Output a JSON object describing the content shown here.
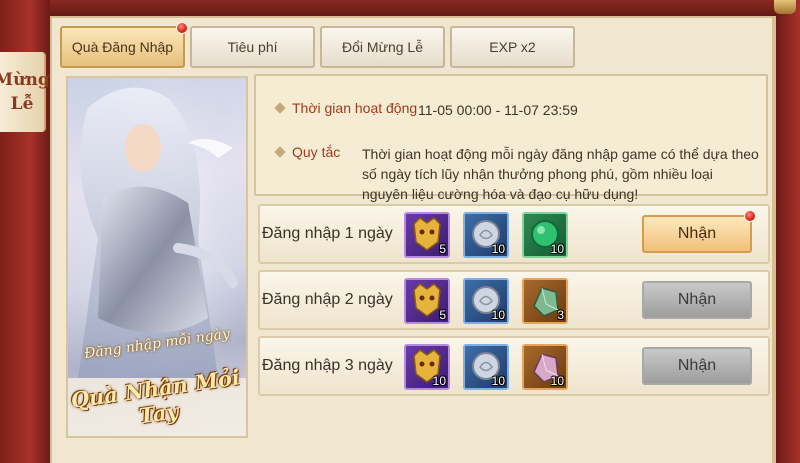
{
  "side_tab": {
    "line1": "Mừng",
    "line2": "Lễ"
  },
  "tabs": [
    {
      "label": "Quà Đăng Nhập",
      "active": true,
      "badge": true
    },
    {
      "label": "Tiêu phí",
      "active": false,
      "badge": false
    },
    {
      "label": "Đổi Mừng Lễ",
      "active": false,
      "badge": false
    },
    {
      "label": "EXP x2",
      "active": false,
      "badge": false
    }
  ],
  "banner": {
    "subtitle": "Đăng nhập mỗi ngày",
    "title": "Quà Nhận Mỏi Tay"
  },
  "info": {
    "time_label": "Thời gian hoạt động",
    "time_value": "11-05 00:00 - 11-07 23:59",
    "rules_label": "Quy tắc",
    "rules_value": "Thời gian hoạt động mỗi ngày đăng nhập game có thể dựa theo số ngày tích lũy nhận thưởng phong phú, gồm nhiều loại nguyên liệu cường hóa và đạo cụ hữu dụng!"
  },
  "rewards": [
    {
      "label": "Đăng nhập 1 ngày",
      "items": [
        {
          "icon": "golden-mask-icon",
          "quality": "purple",
          "count": "5"
        },
        {
          "icon": "silver-coin-icon",
          "quality": "blue",
          "count": "10"
        },
        {
          "icon": "jade-orb-icon",
          "quality": "green",
          "count": "10"
        }
      ],
      "button": "Nhận",
      "claimable": true
    },
    {
      "label": "Đăng nhập 2 ngày",
      "items": [
        {
          "icon": "golden-mask-icon",
          "quality": "purple",
          "count": "5"
        },
        {
          "icon": "silver-coin-icon",
          "quality": "blue",
          "count": "10"
        },
        {
          "icon": "green-crystal-icon",
          "quality": "orange",
          "count": "3"
        }
      ],
      "button": "Nhận",
      "claimable": false
    },
    {
      "label": "Đăng nhập 3 ngày",
      "items": [
        {
          "icon": "golden-mask-icon",
          "quality": "purple",
          "count": "10"
        },
        {
          "icon": "silver-coin-icon",
          "quality": "blue",
          "count": "10"
        },
        {
          "icon": "pink-crystal-icon",
          "quality": "orange",
          "count": "10"
        }
      ],
      "button": "Nhận",
      "claimable": false
    }
  ],
  "colors": {
    "accent": "#f0c07a",
    "badge": "#d9251a",
    "frame": "#8a2a20"
  }
}
